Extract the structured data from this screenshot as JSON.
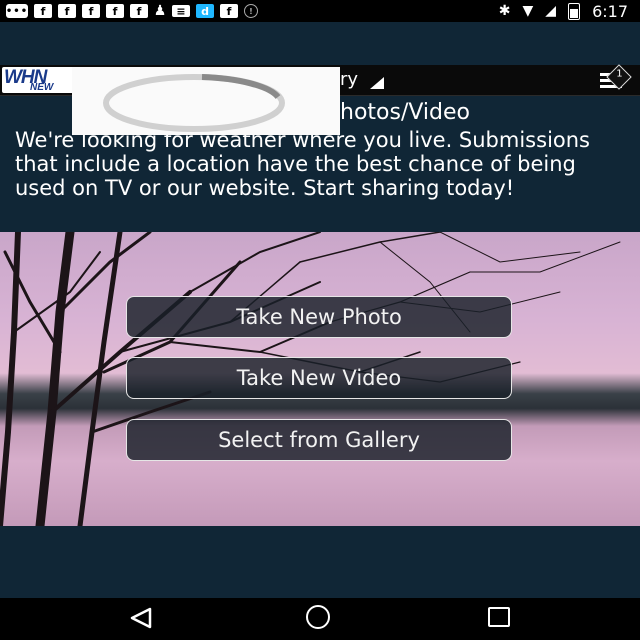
{
  "status_bar": {
    "left_icons": [
      "dots-notification-icon",
      "flipboard-icon",
      "flipboard-icon",
      "flipboard-icon",
      "flipboard-icon",
      "flipboard-icon",
      "person-icon",
      "message-icon",
      "dictionary-icon",
      "flipboard-icon",
      "circle-icon"
    ],
    "right_icons": [
      "bluetooth-icon",
      "wifi-icon",
      "no-signal-icon",
      "battery-icon"
    ],
    "time": "6:17"
  },
  "header": {
    "logo_main": "WHN",
    "logo_sub": "NEW",
    "section_title_visible": "ry",
    "menu_badge": "1"
  },
  "content": {
    "heading_visible": "hotos/Video",
    "intro": "We're looking for weather where you live. Submissions that include a location have the best chance of being used on TV or our website. Start sharing today!"
  },
  "actions": {
    "take_photo": "Take New Photo",
    "take_video": "Take New Video",
    "gallery": "Select from Gallery"
  },
  "colors": {
    "background": "#102636",
    "status_bar": "#000000",
    "accent_blue": "#1fb7ff"
  }
}
